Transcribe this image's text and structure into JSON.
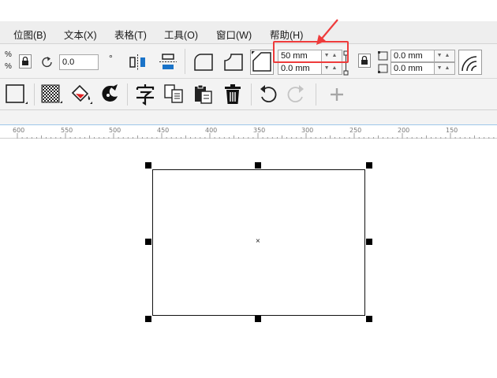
{
  "menu": [
    {
      "label": "位图(B)"
    },
    {
      "label": "文本(X)"
    },
    {
      "label": "表格(T)"
    },
    {
      "label": "工具(O)"
    },
    {
      "label": "窗口(W)"
    },
    {
      "label": "帮助(H)"
    }
  ],
  "property_bar": {
    "percent_top": "%",
    "percent_bottom": "%",
    "rotation_value": "0.0",
    "rotation_unit": "°",
    "corner_top": "50 mm",
    "corner_bottom": "0.0 mm",
    "right_top": "0.0 mm",
    "right_bottom": "0.0 mm"
  },
  "ruler": {
    "labels": [
      "600",
      "550",
      "500",
      "450",
      "400",
      "350",
      "300",
      "250",
      "200",
      "150"
    ]
  },
  "colors": {
    "callout": "#ee3b3b",
    "accent_blue": "#1a73c8",
    "accent_red": "#e02020"
  }
}
